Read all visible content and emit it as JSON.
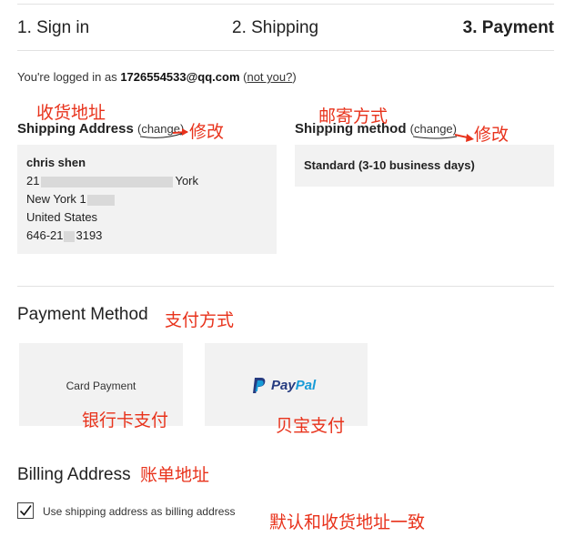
{
  "steps": [
    {
      "label": "1. Sign in"
    },
    {
      "label": "2. Shipping"
    },
    {
      "label": "3. Payment"
    }
  ],
  "account": {
    "prefix": "You're logged in as ",
    "email": "1726554533@qq.com",
    "not_you_open": " (",
    "not_you": "not you?",
    "not_you_close": ")"
  },
  "shipping_address": {
    "annotation": "收货地址",
    "heading": "Shipping Address",
    "change_label": "change",
    "edit_annotation": "修改",
    "name": "chris shen",
    "line1_start": "21",
    "line1_end": "York",
    "line2_start": "New York 1",
    "country": "United States",
    "phone_start": "646-21",
    "phone_end": "3193"
  },
  "shipping_method": {
    "annotation": "邮寄方式",
    "heading": "Shipping method",
    "change_label": "change",
    "edit_annotation": "修改",
    "value": "Standard (3-10 business days)"
  },
  "payment_method": {
    "heading": "Payment Method",
    "annotation": "支付方式",
    "options": [
      {
        "label": "Card Payment",
        "annotation": "银行卡支付"
      },
      {
        "label": "PayPal",
        "annotation": "贝宝支付"
      }
    ]
  },
  "billing": {
    "heading": "Billing Address",
    "annotation": "账单地址",
    "checkbox_label": "Use shipping address as billing address",
    "checkbox_checked": true,
    "checkbox_annotation": "默认和收货地址一致"
  },
  "colors": {
    "annotation": "#e8321b",
    "paypal_dark": "#253b80",
    "paypal_light": "#179bd7",
    "panel": "#f2f2f2"
  }
}
